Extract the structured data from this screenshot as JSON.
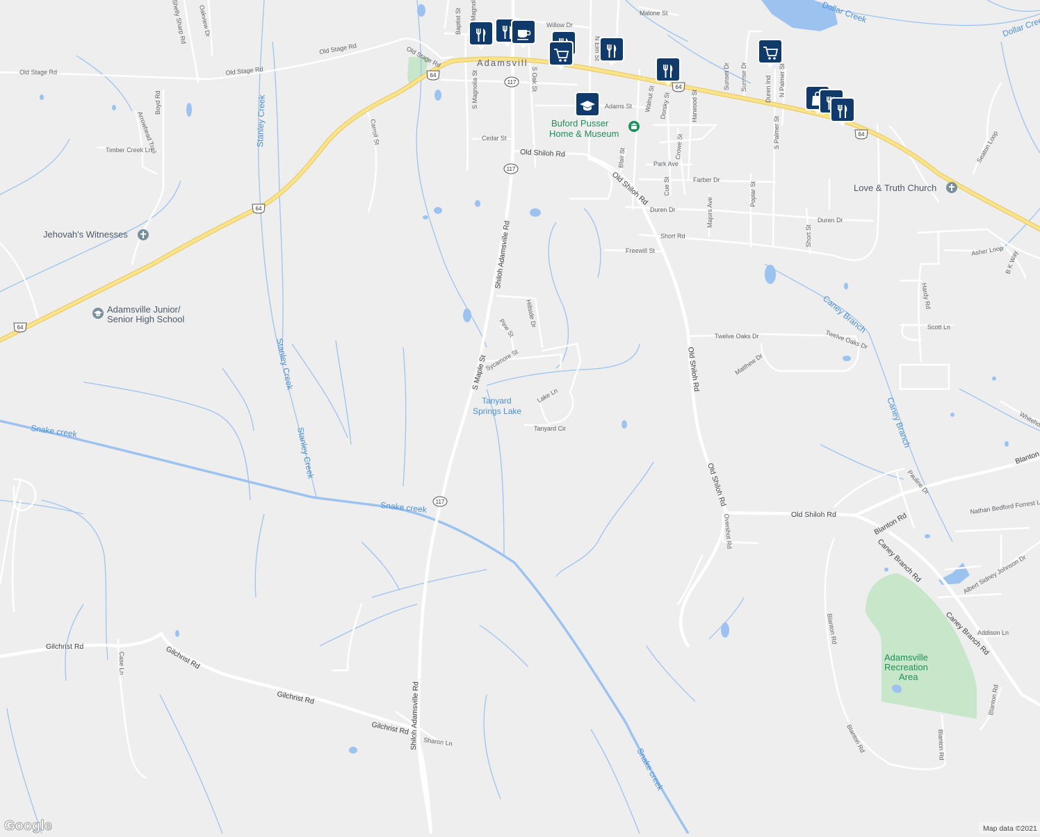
{
  "map": {
    "town": "Adamsvill",
    "credit": "Map data ©2021",
    "logo": "Google",
    "colors": {
      "land": "#efeeee",
      "road": "#ffffff",
      "highway": "#f9e38b",
      "water": "#9cc3f0",
      "park": "#c8e6c9",
      "marker": "#0f3a6b"
    },
    "shields": [
      "64",
      "117"
    ],
    "roads": {
      "old_stage": "Old Stage Rd",
      "willow": "Willow Dr",
      "baptist": "Baptist St",
      "magnolia": "S Magnolia St",
      "magnolia_top": "Magnolia",
      "oak": "S Oak St",
      "elm": "N Elm St",
      "adams": "Adams St",
      "walnut": "Walnut St",
      "dorsky": "Dorsky St",
      "sunset": "Sunset Dr",
      "sunrise": "Sunrise Dr",
      "duren_ind": "Duren Ind",
      "palmer_n": "N Palmer St",
      "palmer_s": "S Palmer St",
      "harwood": "Harwood St",
      "cedar": "Cedar St",
      "old_shiloh": "Old Shiloh Rd",
      "blair": "Blair St",
      "park_ave": "Park Ave",
      "cue": "Cue St",
      "crowe": "Crowe St",
      "farber": "Farber Dr",
      "duren": "Duren Dr",
      "majors": "Majors Ave",
      "poplar": "Poplar St",
      "short_rd": "Short Rd",
      "short_st": "Short St",
      "freewill": "Freewill St",
      "shiloh_adamsville": "Shiloh Adamsville Rd",
      "s_maple": "S Maple St",
      "hillside": "Hillside Dr",
      "pine": "Pine St",
      "sycamore": "Sycamore St",
      "lake_ln": "Lake Ln",
      "tanyard_cir": "Tanyard Cir",
      "twelve_oaks": "Twelve Oaks Dr",
      "matthew": "Matthew Dr",
      "boyd": "Boyd Rd",
      "arrowhead": "Arrowhead Trail",
      "timber": "Timber Creek Ln",
      "carroll": "Carroll St",
      "sharp": "Shelly Sharp Rd",
      "oakview": "Oakview Dr",
      "malone": "Malone St",
      "seaton": "Seaton Loop",
      "asher": "Asher Loop",
      "bk_way": "B K Way",
      "hardy": "Hardy Rd",
      "scott": "Scott Ln",
      "whitehorse": "Whitehor",
      "blanton_rd": "Blanton Rd",
      "blanton_right": "Blanton",
      "pauline": "Pauline Dr",
      "nathan": "Nathan Bedford Forrest Ln",
      "albert": "Albert Sidney Johnson Dr",
      "caney_branch_rd": "Caney Branch Rd",
      "addison": "Addison Ln",
      "overshot": "Overshot Rd",
      "gilchrist": "Gilchrist Rd",
      "case": "Case Ln",
      "sharon": "Sharon Ln"
    },
    "water": {
      "stanley": "Stanley Creek",
      "snake": "Snake creek",
      "caney": "Caney Branch",
      "dollar": "Dollar Creek",
      "tanyard_1": "Tanyard",
      "tanyard_2": "Springs Lake"
    },
    "places": {
      "buford_1": "Buford Pusser",
      "buford_2": "Home & Museum",
      "love_truth": "Love & Truth Church",
      "jehovah": "Jehovah's Witnesses",
      "school_1": "Adamsville Junior/",
      "school_2": "Senior High School",
      "rec_1": "Adamsville",
      "rec_2": "Recreation",
      "rec_3": "Area"
    },
    "markers": [
      {
        "type": "restaurant-icon"
      },
      {
        "type": "restaurant-icon"
      },
      {
        "type": "cafe-icon"
      },
      {
        "type": "restaurant-icon"
      },
      {
        "type": "shopping-cart-icon"
      },
      {
        "type": "restaurant-icon"
      },
      {
        "type": "school-icon"
      },
      {
        "type": "restaurant-icon"
      },
      {
        "type": "shopping-cart-icon"
      },
      {
        "type": "shopping-bag-icon"
      },
      {
        "type": "restaurant-icon"
      }
    ]
  }
}
